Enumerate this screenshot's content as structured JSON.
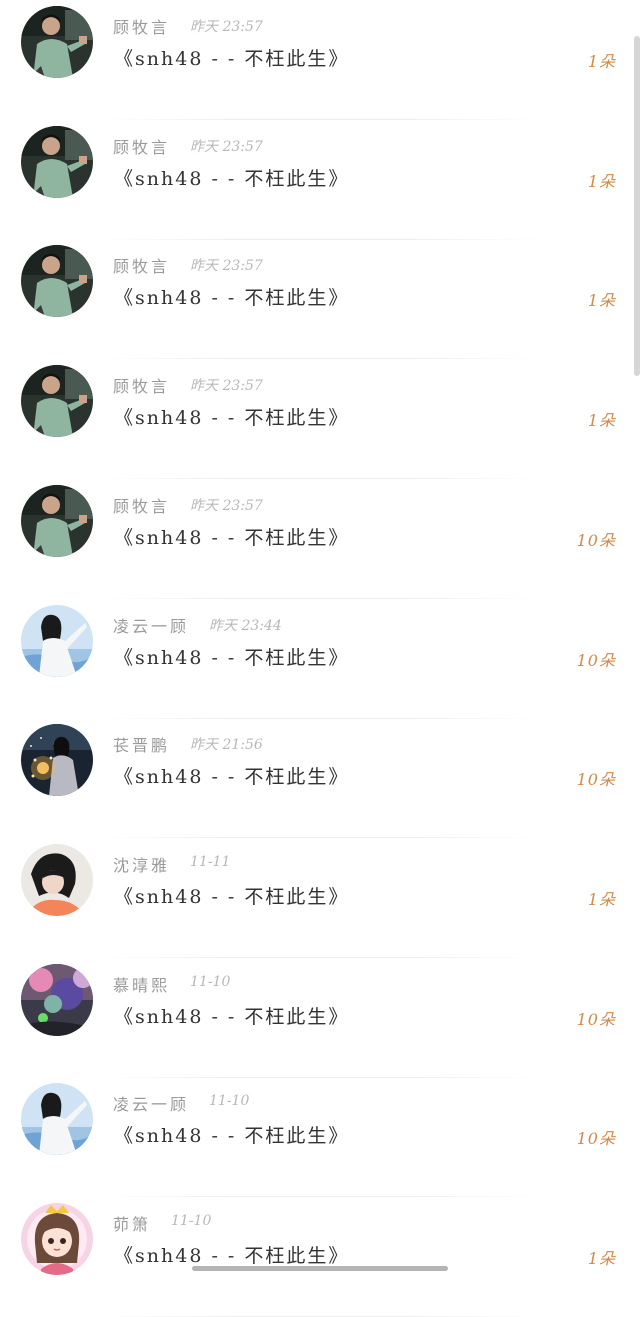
{
  "comments": [
    {
      "name": "顾牧言",
      "time": "昨天 23:57",
      "song": "《snh48 - - 不枉此生》",
      "flowers": "1朵",
      "avatar": "avatar-green-shirt-man"
    },
    {
      "name": "顾牧言",
      "time": "昨天 23:57",
      "song": "《snh48 - - 不枉此生》",
      "flowers": "1朵",
      "avatar": "avatar-green-shirt-man"
    },
    {
      "name": "顾牧言",
      "time": "昨天 23:57",
      "song": "《snh48 - - 不枉此生》",
      "flowers": "1朵",
      "avatar": "avatar-green-shirt-man"
    },
    {
      "name": "顾牧言",
      "time": "昨天 23:57",
      "song": "《snh48 - - 不枉此生》",
      "flowers": "1朵",
      "avatar": "avatar-green-shirt-man"
    },
    {
      "name": "顾牧言",
      "time": "昨天 23:57",
      "song": "《snh48 - - 不枉此生》",
      "flowers": "10朵",
      "avatar": "avatar-green-shirt-man"
    },
    {
      "name": "凌云一顾",
      "time": "昨天 23:44",
      "song": "《snh48 - - 不枉此生》",
      "flowers": "10朵",
      "avatar": "avatar-girl-white-dress"
    },
    {
      "name": "苌晋鹏",
      "time": "昨天 21:56",
      "song": "《snh48 - - 不枉此生》",
      "flowers": "10朵",
      "avatar": "avatar-girl-sparkler"
    },
    {
      "name": "沈淳雅",
      "time": "11-11",
      "song": "《snh48 - - 不枉此生》",
      "flowers": "1朵",
      "avatar": "avatar-girl-orange"
    },
    {
      "name": "慕晴熙",
      "time": "11-10",
      "song": "《snh48 - - 不枉此生》",
      "flowers": "10朵",
      "avatar": "avatar-balloons"
    },
    {
      "name": "凌云一顾",
      "time": "11-10",
      "song": "《snh48 - - 不枉此生》",
      "flowers": "10朵",
      "avatar": "avatar-girl-white-dress"
    },
    {
      "name": "茆箫",
      "time": "11-10",
      "song": "《snh48 - - 不枉此生》",
      "flowers": "1朵",
      "avatar": "avatar-cartoon-girl"
    }
  ]
}
